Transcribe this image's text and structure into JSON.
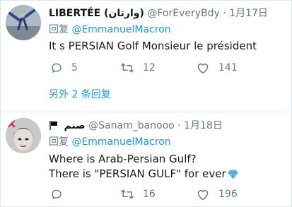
{
  "tweets": [
    {
      "name": "LIBERTÉE (وارتان)",
      "handle": "@ForEveryBdy",
      "dot": "·",
      "date": "1月17日",
      "reply_prefix": "回复",
      "reply_to": "@EmmanuelMacron",
      "text": [
        "It s PERSIAN Golf Monsieur le président"
      ],
      "replies": "5",
      "retweets": "12",
      "likes": "141",
      "more_replies": "另外 2 条回复"
    },
    {
      "name": "صنم",
      "handle": "@Sanam_banooo",
      "dot": "·",
      "date": "1月18日",
      "reply_prefix": "回复",
      "reply_to": "@EmmanuelMacron",
      "text": [
        "Where is Arab-Persian Gulf?",
        "There is \"PERSIAN GULF\" for ever"
      ],
      "replies": "",
      "retweets": "16",
      "likes": "196"
    }
  ],
  "colors": {
    "link": "#1b95e0",
    "muted": "#657786",
    "text": "#14171a",
    "border": "#e1e8ed"
  },
  "icons": {
    "reply": "speech-bubble-icon",
    "retweet": "retweet-arrows-icon",
    "like": "heart-icon",
    "flag": "black-flag-icon",
    "gem": "gem-icon"
  }
}
